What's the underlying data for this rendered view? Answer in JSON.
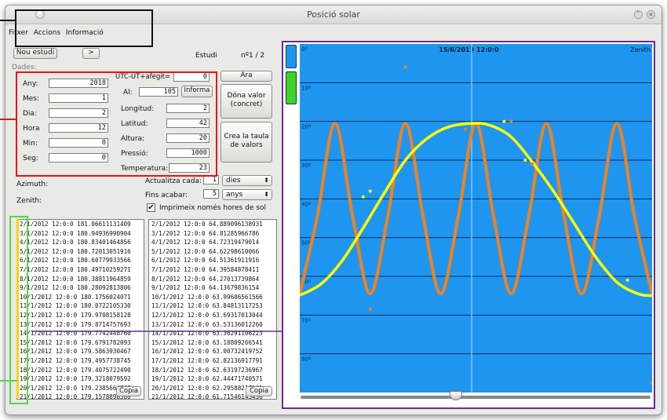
{
  "window": {
    "title": "Posició solar"
  },
  "menu": [
    {
      "id": "file",
      "label": "Fitxer"
    },
    {
      "id": "actions",
      "label": "Accions"
    },
    {
      "id": "info",
      "label": "Informació"
    }
  ],
  "toolbar": {
    "new_study": "Nou estudi",
    "next": ">",
    "study_label": "Estudi",
    "study_count": "nº1 / 2"
  },
  "data_section_label": "Dades:",
  "inputs": {
    "year": {
      "label": "Any:",
      "value": "2018"
    },
    "month": {
      "label": "Mes:",
      "value": "1"
    },
    "day": {
      "label": "Dia:",
      "value": "2"
    },
    "hour": {
      "label": "Hora",
      "value": "12"
    },
    "min": {
      "label": "Min:",
      "value": "0"
    },
    "sec": {
      "label": "Seg:",
      "value": "0"
    },
    "utc": {
      "label": "UTC-UT+afegit=",
      "value": "0"
    },
    "alt": {
      "label": "Al:",
      "value": "105"
    },
    "longitude": {
      "label": "Longitud:",
      "value": "2"
    },
    "latitude": {
      "label": "Latitud:",
      "value": "42"
    },
    "height": {
      "label": "Altura:",
      "value": "20"
    },
    "pressure": {
      "label": "Pressió:",
      "value": "1000"
    },
    "temperature": {
      "label": "Temperatura:",
      "value": "23"
    }
  },
  "buttons": {
    "informa": "Informa",
    "now": "Ara",
    "give_value": "Dóna valor (concret)",
    "create_table": "Crea la taula de valors",
    "copy_left": "Copia",
    "copy_right": "Copia"
  },
  "update": {
    "label": "Actualitza cada:",
    "value": "1",
    "unit": "dies",
    "until_label": "Fins acabar:",
    "until_value": "5",
    "until_unit": "anys",
    "only_sun_label": "Imprimeix només hores de sol",
    "only_sun_checked": true
  },
  "azimuth_label": "Azimuth:",
  "zenith_label": "Zenith:",
  "azimuth_table": [
    "2/1/2012 12:0:0 181.06611131409",
    "3/1/2012 12:0:0 180.94936990904",
    "4/1/2012 12:0:0 180.83401464856",
    "5/1/2012 12:0:0 180.72013051916",
    "6/1/2012 12:0:0 180.60779933566",
    "7/1/2012 12:0:0 180.49710259271",
    "8/1/2012 12:0:0 180.38811964859",
    "9/1/2012 12:0:0 180.28092813806",
    "10/1/2012 12:0:0 180.1756024071",
    "11/1/2012 12:0:0 180.0722105330",
    "12/1/2012 12:0:0 179.9708158128",
    "13/1/2012 12:0:0 179.8714757693",
    "14/1/2012 12:0:0 179.7742448760",
    "15/1/2012 12:0:0 179.6791782093",
    "16/1/2012 12:0:0 179.5863930467",
    "17/1/2012 12:0:0 179.4957738745",
    "18/1/2012 12:0:0 179.4075722490",
    "19/1/2012 12:0:0 179.3218079592",
    "20/1/2012 12:0:0 179.2385664767",
    "21/1/2012 12:0:0 179.1578890580",
    "22/1/2012 12:0:0 179.0797"
  ],
  "zenith_table": [
    "2/1/2012 12:0:0 64.889096138931",
    "3/1/2012 12:0:0 64.81285966786",
    "4/1/2012 12:0:0 64.72319479014",
    "5/1/2012 12:0:0 64.62298610066",
    "6/1/2012 12:0:0 64.51361911916",
    "7/1/2012 12:0:0 64.39584878411",
    "8/1/2012 12:0:0 64.27013739864",
    "9/1/2012 12:0:0 64.13679836154",
    "10/1/2012 12:0:0 63.99606561566",
    "11/1/2012 12:0:0 63.84813117253",
    "12/1/2012 12:0:0 63.69317013044",
    "13/1/2012 12:0:0 63.53136012260",
    "14/1/2012 12:0:0 63.36291106223",
    "15/1/2012 12:0:0 63.18809266541",
    "16/1/2012 12:0:0 63.00732419752",
    "17/1/2012 12:0:0 62.82136917791",
    "18/1/2012 12:0:0 62.63197236967",
    "19/1/2012 12:0:0 62.44471740571",
    "20/1/2012 12:0:0 62.29588217961",
    "21/1/2012 12:0:0 61.71546145436",
    "22/1/2012 12:0:0 61.4399"
  ],
  "chart_data": {
    "type": "line",
    "title": "15/6/2013 12:0:0",
    "top_right_label": "Zenith",
    "y_ticks": [
      "0º",
      "10º",
      "20º",
      "30º",
      "40º",
      "50º",
      "60º",
      "70º",
      "80º"
    ],
    "ylim": [
      0,
      90
    ],
    "xlim": [
      0,
      1
    ],
    "cursor_x": 0.488,
    "grid": true,
    "series": [
      {
        "color": "#ffff00",
        "x": [
          0,
          0.06,
          0.12,
          0.18,
          0.24,
          0.3,
          0.36,
          0.42,
          0.488,
          0.54,
          0.6,
          0.66,
          0.72,
          0.78,
          0.84,
          0.9,
          0.96,
          1
        ],
        "y": [
          64.9,
          62.0,
          56.0,
          47.5,
          38.5,
          30.0,
          24.5,
          21.5,
          20.5,
          21.0,
          24.0,
          30.5,
          38.0,
          46.5,
          55.0,
          61.5,
          64.5,
          65.0
        ]
      },
      {
        "color": "#f0821e",
        "x": [
          0,
          0.05,
          0.1,
          0.15,
          0.2,
          0.25,
          0.3,
          0.35,
          0.4,
          0.45,
          0.5,
          0.55,
          0.6,
          0.65,
          0.7,
          0.75,
          0.8,
          0.85,
          0.9,
          0.95,
          1
        ],
        "y": [
          64.5,
          44.5,
          20.5,
          44.5,
          64.5,
          44.5,
          20.5,
          44.5,
          64.5,
          44.5,
          20.5,
          44.5,
          64.5,
          44.5,
          20.5,
          44.5,
          64.5,
          44.5,
          20.5,
          44.5,
          64.5
        ]
      }
    ],
    "scatter_points": {
      "yellow": [
        [
          0.18,
          39.5
        ],
        [
          0.2,
          38.0
        ],
        [
          0.58,
          20.0
        ],
        [
          0.64,
          30.0
        ],
        [
          0.93,
          61.0
        ]
      ],
      "orange": [
        [
          0.3,
          6.0
        ],
        [
          0.2,
          68.5
        ],
        [
          0.47,
          22.0
        ],
        [
          0.6,
          20.0
        ],
        [
          1.0,
          87.5
        ],
        [
          0.66,
          31.0
        ]
      ]
    },
    "colors": {
      "background": "#1e96f0",
      "grid": "#0d2a5e",
      "cursor": "#7cc8ff"
    }
  },
  "annotation_colors": {
    "menu_box": "#111111",
    "inputs_box": "#e8121a",
    "list_box": "#5fd14a",
    "chart_box": "#6a2c91"
  }
}
